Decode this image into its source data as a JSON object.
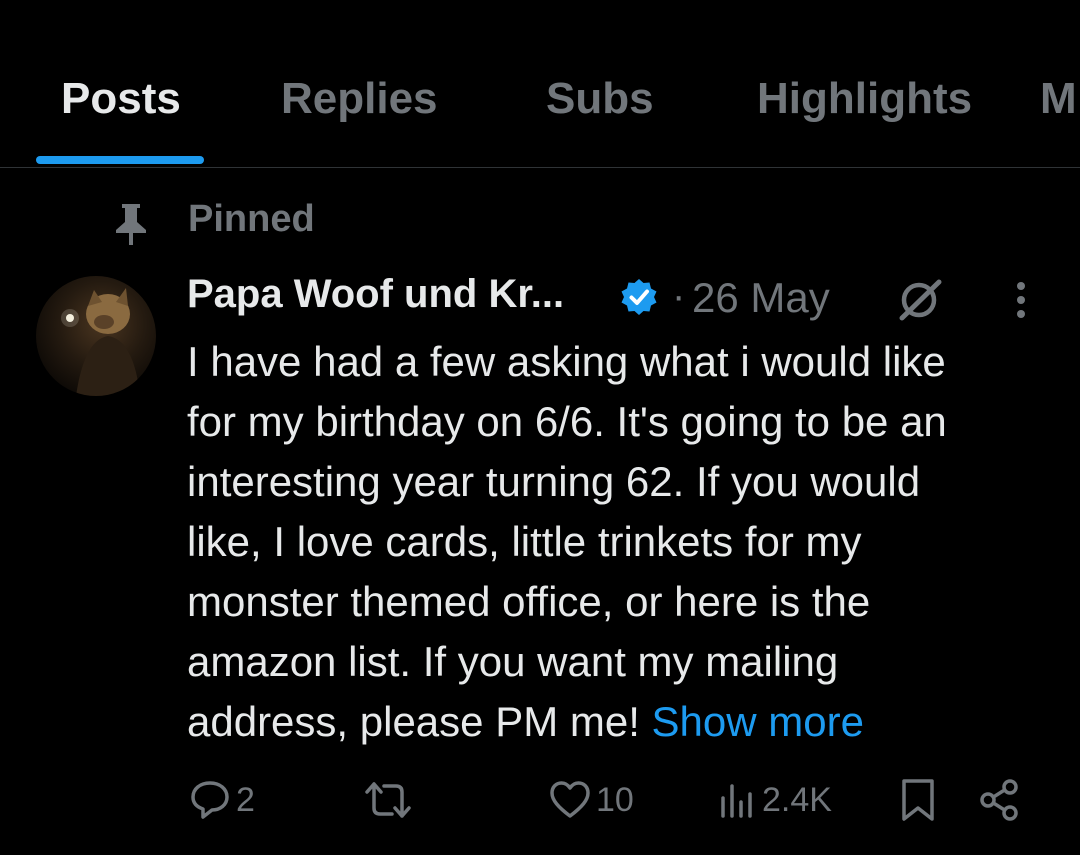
{
  "tabs": [
    {
      "label": "Posts",
      "active": true
    },
    {
      "label": "Replies",
      "active": false
    },
    {
      "label": "Subs",
      "active": false
    },
    {
      "label": "Highlights",
      "active": false
    },
    {
      "label": "M",
      "active": false
    }
  ],
  "pinned": {
    "label": "Pinned",
    "icon": "pin-icon"
  },
  "post": {
    "author": "Papa Woof und Kr...",
    "verified": true,
    "separator": "·",
    "date": "26 May",
    "body_lines": [
      "I have had a few asking what i would like",
      "for my birthday on 6/6. It's going to be an",
      "interesting year turning 62. If you would",
      "like, I love cards, little trinkets for my",
      "monster themed office, or here is the",
      "amazon list. If you want my mailing",
      "address, please PM me! "
    ],
    "show_more": "Show more",
    "actions": {
      "replies": "2",
      "reposts": "",
      "likes": "10",
      "views": "2.4K"
    }
  },
  "colors": {
    "accent": "#1d9bf0",
    "muted": "#71767b",
    "text": "#e7e9ea",
    "background": "#000000"
  },
  "icons": [
    "pin-icon",
    "verified-badge-icon",
    "grok-icon",
    "more-options-icon",
    "reply-icon",
    "repost-icon",
    "like-icon",
    "views-icon",
    "bookmark-icon",
    "share-icon"
  ]
}
